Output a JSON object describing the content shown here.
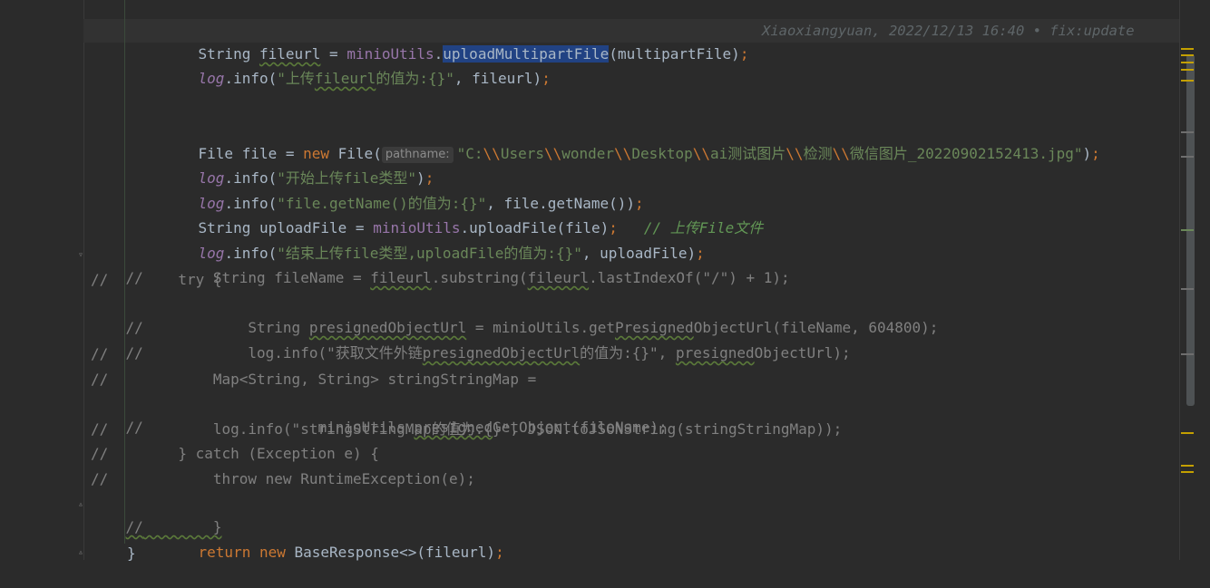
{
  "code": {
    "l1": {
      "t1": "String ",
      "t2": "fileurl",
      "t3": " = ",
      "t4": "minioUtils",
      "t5": ".",
      "t6": "uploadMultipartFile",
      "t7": "(multipartFile)",
      "t8": ";"
    },
    "blame": "Xiaoxiangyuan, 2022/12/13 16:40 • fix:update",
    "blame_tail": "/",
    "l2": {
      "t1": "log",
      "t2": ".info(",
      "t3": "\"上传",
      "t4": "fileurl",
      "t5": "的值为:{}\"",
      "t6": ", fileurl)",
      "t7": ";"
    },
    "l3": {
      "t1": "File file = ",
      "t2": "new ",
      "t3": "File(",
      "hint": "pathname:",
      "t4": "\"C:",
      "t5": "\\\\",
      "t6": "Users",
      "t7": "\\\\",
      "t8": "wonder",
      "t9": "\\\\",
      "t10": "Desktop",
      "t11": "\\\\",
      "t12": "ai测试图片",
      "t13": "\\\\",
      "t14": "检测",
      "t15": "\\\\",
      "t16": "微信图片_20220902152413.jpg\"",
      "t17": ")",
      "t18": ";"
    },
    "l4": {
      "t1": "log",
      "t2": ".info(",
      "t3": "\"开始上传file类型\"",
      "t4": ")",
      "t5": ";"
    },
    "l5": {
      "t1": "log",
      "t2": ".info(",
      "t3": "\"file.getName()的值为:{}\"",
      "t4": ", file.getName())",
      "t5": ";"
    },
    "l6": {
      "t1": "String uploadFile = ",
      "t2": "minioUtils",
      "t3": ".uploadFile(file)",
      "t4": ";",
      "t5": "   // ",
      "t6": "上传File文件"
    },
    "l7": {
      "t1": "log",
      "t2": ".info(",
      "t3": "\"结束上传file类型,uploadFile的值为:{}\"",
      "t4": ", uploadFile)",
      "t5": ";"
    },
    "c1": {
      "a": "//",
      "b": "        String fileName = ",
      "c": "fileurl",
      "d": ".substring(",
      "e": "fileurl",
      "f": ".lastIndexOf(\"/\") + 1);"
    },
    "c2": "//        try {",
    "c3": {
      "a": "//            String ",
      "b": "presignedObjectUrl",
      "c": " = minioUtils.get",
      "d": "Presigned",
      "e": "ObjectUrl(fileName, 604800);"
    },
    "c4": {
      "a": "//            log.info(\"获取文件外链",
      "b": "presignedObjectUrl",
      "c": "的值为:{}\", ",
      "d": "presigned",
      "e": "ObjectUrl);"
    },
    "c5": "//",
    "c6": "//            Map<String, String> stringStringMap =",
    "c7": {
      "a": "//                    minioUtils.",
      "b": "presigned",
      "c": "GetObject(fileName);"
    },
    "c8": "//            log.info(\"stringStringMap的值为:{}\", JSON.toJSONString(stringStringMap));",
    "c9": "//        } catch (Exception e) {",
    "c10": "//            throw new RuntimeException(e);",
    "c11": {
      "a": "//",
      "b": "        }"
    },
    "l8": {
      "t1": "return ",
      "t2": "new ",
      "t3": "BaseResponse<>(fileurl)",
      "t4": ";"
    },
    "l9": "}"
  },
  "colors": {
    "background": "#2b2b2b",
    "keyword": "#cc7832",
    "string": "#6a8759",
    "field": "#9876aa",
    "comment": "#808080",
    "selection": "#214283"
  }
}
